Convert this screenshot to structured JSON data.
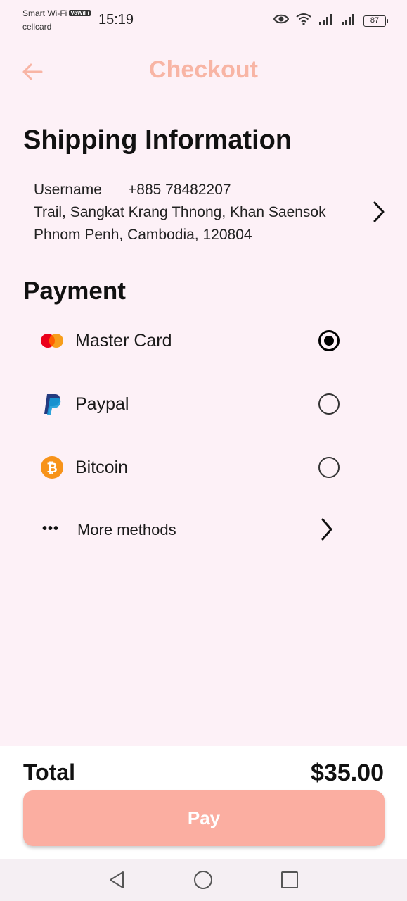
{
  "status_bar": {
    "carrier_primary": "Smart Wi-Fi",
    "volte_badge": "VoWiFi",
    "carrier_secondary": "cellcard",
    "time": "15:19",
    "battery_level": "87"
  },
  "header": {
    "title": "Checkout",
    "back_icon": "arrow-left-icon"
  },
  "shipping": {
    "title": "Shipping Information",
    "name": "Username",
    "phone": "+885 78482207",
    "address_line1": "Trail, Sangkat Krang Thnong, Khan Saensok",
    "address_line2": "Phnom Penh, Cambodia, 120804"
  },
  "payment": {
    "title": "Payment",
    "options": [
      {
        "label": "Master Card",
        "icon": "mastercard-icon",
        "selected": true
      },
      {
        "label": "Paypal",
        "icon": "paypal-icon",
        "selected": false
      },
      {
        "label": "Bitcoin",
        "icon": "bitcoin-icon",
        "selected": false
      }
    ],
    "more_label": "More methods"
  },
  "summary": {
    "total_label": "Total",
    "total_value": "$35.00",
    "pay_label": "Pay"
  },
  "colors": {
    "accent": "#f8b5a5",
    "pay_button": "#fbaea1",
    "background": "#fdf1f7"
  }
}
